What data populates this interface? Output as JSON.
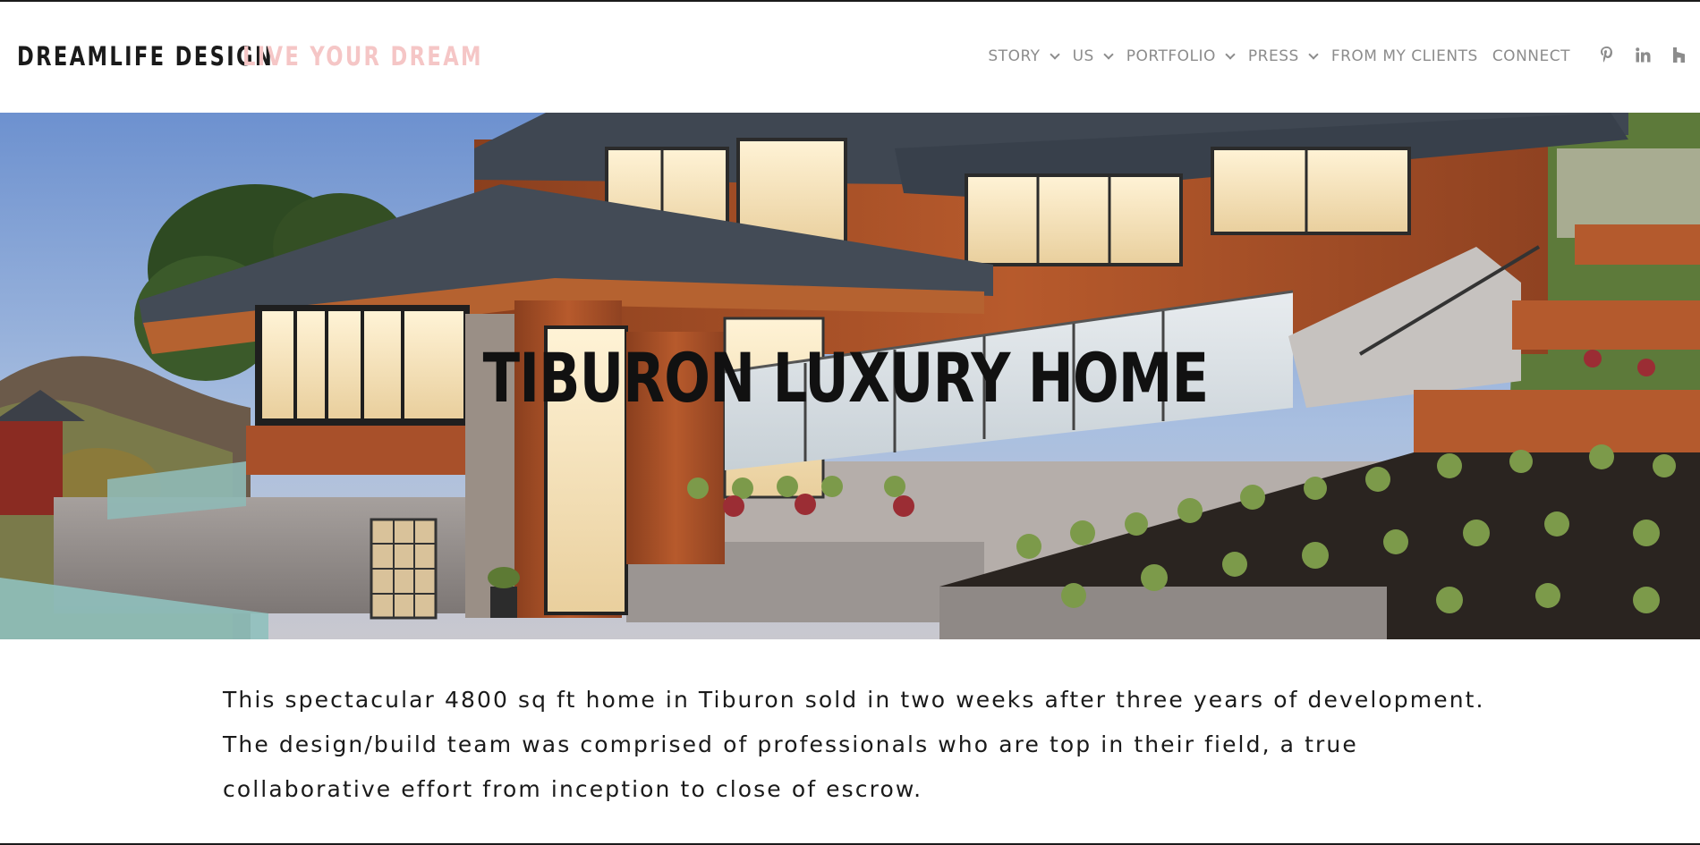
{
  "brand": {
    "name": "DREAMLIFE DESIGN",
    "tagline": "LIVE YOUR DREAM",
    "tagline_color": "#f5c6c6"
  },
  "nav": {
    "items": [
      {
        "label": "STORY",
        "has_dropdown": true
      },
      {
        "label": "US",
        "has_dropdown": true
      },
      {
        "label": "PORTFOLIO",
        "has_dropdown": true
      },
      {
        "label": "PRESS",
        "has_dropdown": true
      },
      {
        "label": "FROM MY CLIENTS",
        "has_dropdown": false
      },
      {
        "label": "CONNECT",
        "has_dropdown": false
      }
    ],
    "social": [
      "pinterest-icon",
      "linkedin-icon",
      "houzz-icon"
    ]
  },
  "hero": {
    "title": "TIBURON LUXURY HOME"
  },
  "content": {
    "description": "This spectacular 4800 sq ft home in Tiburon sold in two weeks after three years of development. The design/build team was comprised of professionals who are top in their field, a true collaborative effort from inception to close of escrow."
  },
  "colors": {
    "nav_text": "#8c8c8c",
    "text": "#1a1a1a"
  }
}
